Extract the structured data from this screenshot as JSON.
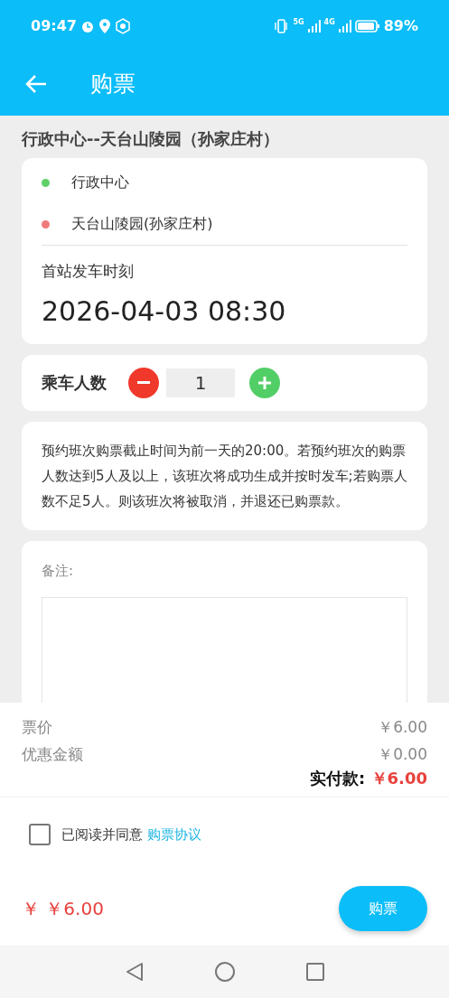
{
  "status_bar": {
    "time": "09:47",
    "network_labels": [
      "5G",
      "4G"
    ],
    "battery": "89%"
  },
  "app_bar": {
    "title": "购票"
  },
  "route_title": "行政中心--天台山陵园（孙家庄村）",
  "stops": [
    {
      "name": "行政中心",
      "color": "#5fd06a"
    },
    {
      "name": "天台山陵园(孙家庄村)",
      "color": "#ee7b79"
    }
  ],
  "departure": {
    "label": "首站发车时刻",
    "value": "2026-04-03 08:30"
  },
  "passengers": {
    "label": "乘车人数",
    "value": "1"
  },
  "notice": "预约班次购票截止时间为前一天的20:00。若预约班次的购票人数达到5人及以上，该班次将成功生成并按时发车;若购票人数不足5人。则该班次将被取消，并退还已购票款。",
  "remark": {
    "label": "备注:"
  },
  "prices": [
    {
      "label": "票价",
      "value": "￥6.00"
    },
    {
      "label": "优惠金额",
      "value": "￥0.00"
    }
  ],
  "total": {
    "label": "实付款:",
    "value": "￥6.00"
  },
  "agreement": {
    "checked": false,
    "text": "已阅读并同意",
    "link": "购票协议"
  },
  "footer": {
    "currency": "￥",
    "amount": "￥6.00",
    "button": "购票"
  }
}
